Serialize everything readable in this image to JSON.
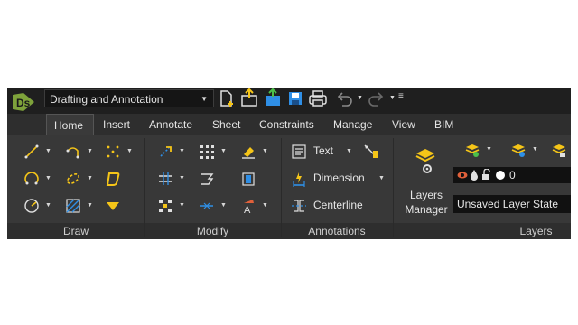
{
  "titlebar": {
    "workspace": "Drafting and Annotation"
  },
  "tabs": [
    "Home",
    "Insert",
    "Annotate",
    "Sheet",
    "Constraints",
    "Manage",
    "View",
    "BIM"
  ],
  "panels": {
    "draw": "Draw",
    "modify": "Modify",
    "annotations": "Annotations",
    "layers": "Layers"
  },
  "annotations": {
    "text": "Text",
    "dimension": "Dimension",
    "centerline": "Centerline"
  },
  "layers": {
    "manager_line1": "Layers",
    "manager_line2": "Manager",
    "current_layer": "0",
    "layer_state": "Unsaved Layer State"
  },
  "colors": {
    "accent_yellow": "#f5c518",
    "accent_blue": "#2f8fe6",
    "accent_green": "#4cc04a",
    "layer_eye_red": "#e0603a"
  }
}
